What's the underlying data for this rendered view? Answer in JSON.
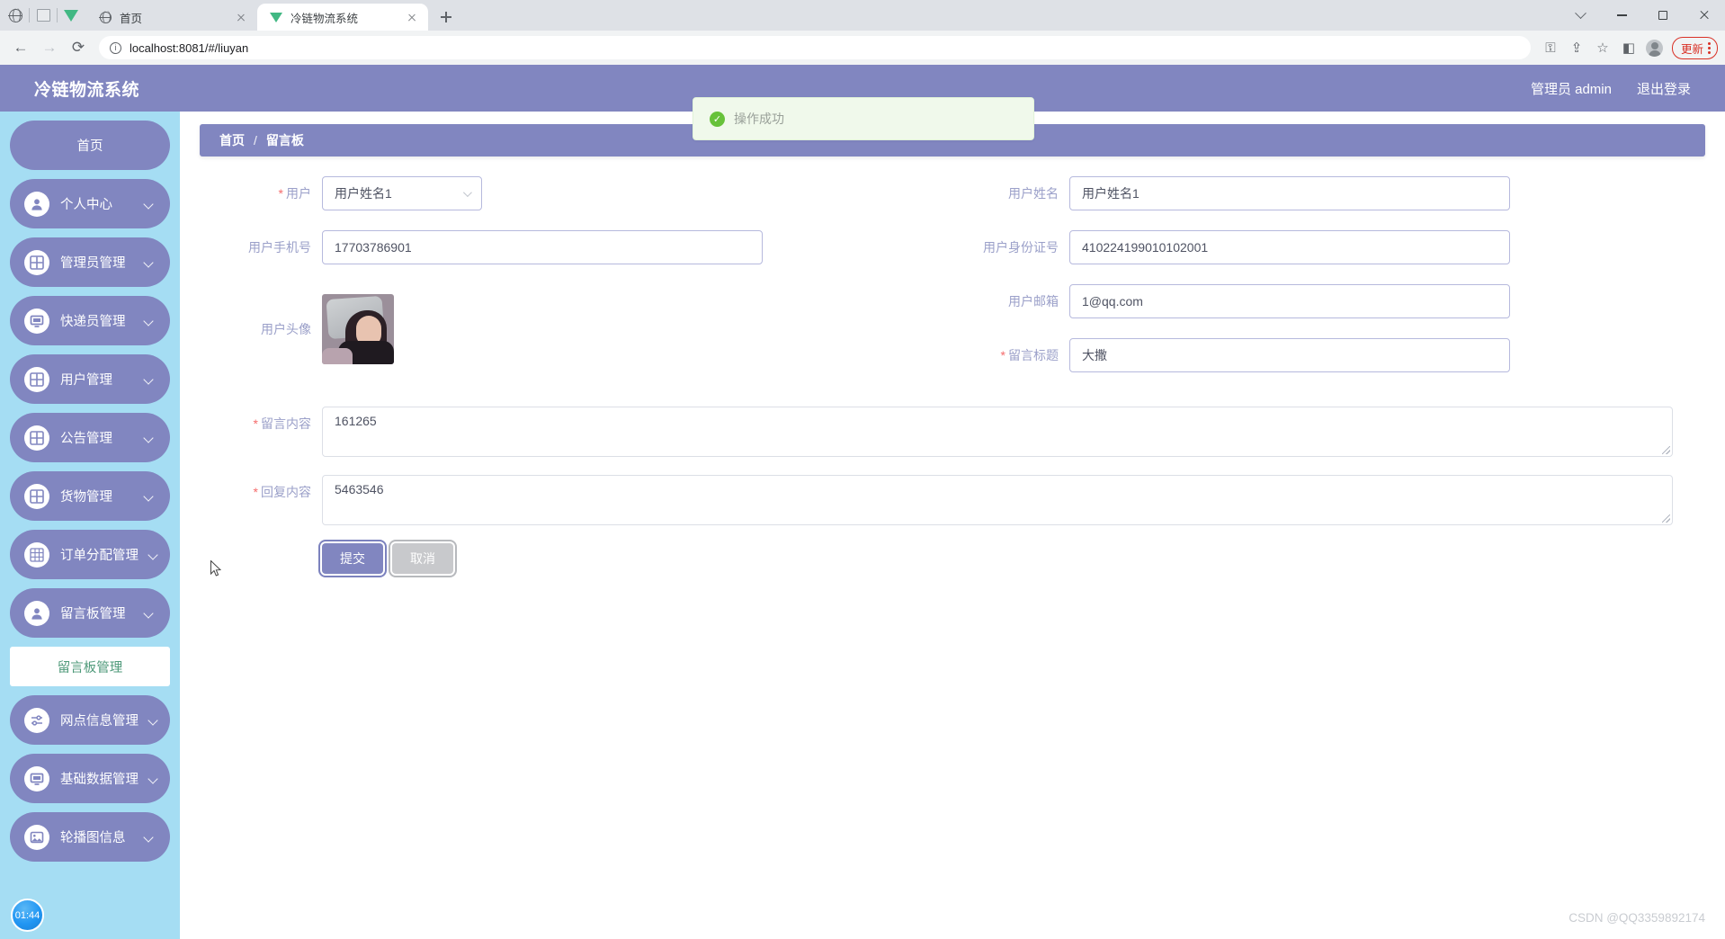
{
  "browser": {
    "tabs": [
      {
        "title": "首页",
        "icon": "globe-icon",
        "active": false
      },
      {
        "title": "冷链物流系统",
        "icon": "vue-icon",
        "active": true
      }
    ],
    "new_tab_label": "+",
    "url": "localhost:8081/#/liuyan",
    "update_label": "更新",
    "nav": {
      "back": "←",
      "forward": "→",
      "reload": "⟳"
    },
    "window": {
      "chevron": "⌄",
      "minimize": "—",
      "maximize": "▢",
      "close": "✕"
    }
  },
  "app": {
    "title": "冷链物流系统",
    "user_label": "管理员 admin",
    "logout_label": "退出登录",
    "toast": {
      "message": "操作成功",
      "icon": "success-check-icon",
      "color": "#67c23a"
    },
    "accent_color": "#8186c0",
    "sidebar_bg": "#a5ddf3"
  },
  "sidebar": {
    "items": [
      {
        "label": "首页",
        "icon": null,
        "expandable": false
      },
      {
        "label": "个人中心",
        "icon": "user-icon",
        "expandable": true
      },
      {
        "label": "管理员管理",
        "icon": "grid-icon",
        "expandable": true
      },
      {
        "label": "快递员管理",
        "icon": "monitor-icon",
        "expandable": true
      },
      {
        "label": "用户管理",
        "icon": "grid-icon",
        "expandable": true
      },
      {
        "label": "公告管理",
        "icon": "grid-icon",
        "expandable": true
      },
      {
        "label": "货物管理",
        "icon": "grid-icon",
        "expandable": true
      },
      {
        "label": "订单分配管理",
        "icon": "table-icon",
        "expandable": true
      },
      {
        "label": "留言板管理",
        "icon": "user-icon",
        "expandable": true
      },
      {
        "label": "网点信息管理",
        "icon": "sliders-icon",
        "expandable": true
      },
      {
        "label": "基础数据管理",
        "icon": "monitor-icon",
        "expandable": true
      },
      {
        "label": "轮播图信息",
        "icon": "picture-icon",
        "expandable": true
      }
    ],
    "active_submenu": {
      "label": "留言板管理",
      "parent": "留言板管理"
    }
  },
  "breadcrumb": {
    "root": "首页",
    "separator": "/",
    "current": "留言板"
  },
  "form": {
    "fields": {
      "user": {
        "label": "用户",
        "required": true,
        "value": "用户姓名1",
        "type": "select",
        "chevron": "chevron-down-icon"
      },
      "user_phone": {
        "label": "用户手机号",
        "required": false,
        "value": "17703786901"
      },
      "user_avatar": {
        "label": "用户头像",
        "required": false,
        "value": ""
      },
      "user_name": {
        "label": "用户姓名",
        "required": false,
        "value": "用户姓名1"
      },
      "user_idcard": {
        "label": "用户身份证号",
        "required": false,
        "value": "410224199010102001"
      },
      "user_email": {
        "label": "用户邮箱",
        "required": false,
        "value": "1@qq.com"
      },
      "message_title": {
        "label": "留言标题",
        "required": true,
        "value": "大撒"
      },
      "message_content": {
        "label": "留言内容",
        "required": true,
        "value": "161265"
      },
      "reply_content": {
        "label": "回复内容",
        "required": true,
        "value": "5463546"
      }
    },
    "buttons": {
      "submit": "提交",
      "cancel": "取消"
    }
  },
  "overlay": {
    "timer": "01:44",
    "watermark": "CSDN @QQ3359892174"
  }
}
